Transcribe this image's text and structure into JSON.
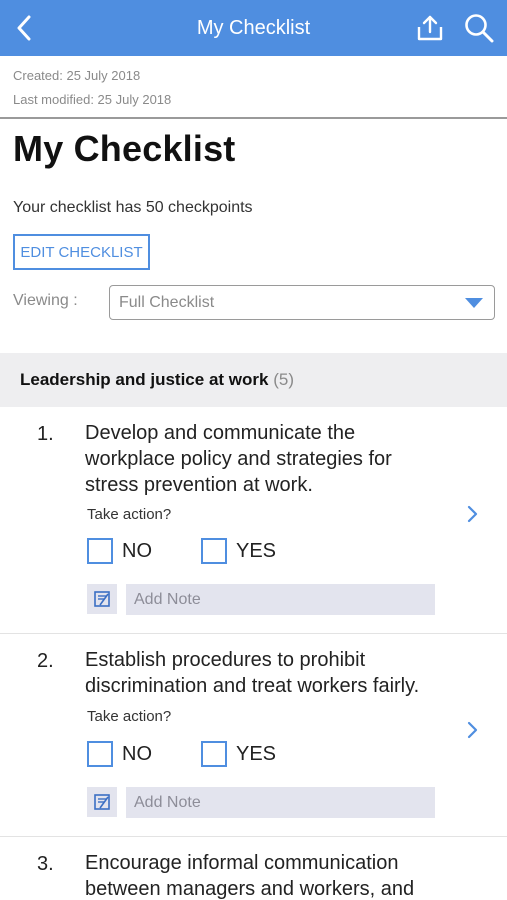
{
  "header": {
    "title": "My Checklist",
    "back_icon": "chevron-left-icon",
    "share_icon": "share-icon",
    "search_icon": "search-icon",
    "bar_color": "#4f8ee0"
  },
  "meta": {
    "created": "Created: 25 July 2018",
    "last_modified": "Last modified: 25 July 2018"
  },
  "page": {
    "title": "My Checklist",
    "summary": "Your checklist has 50 checkpoints",
    "edit_button": "EDIT CHECKLIST",
    "viewing_label": "Viewing :",
    "viewing_value": "Full Checklist"
  },
  "section": {
    "name": "Leadership and justice at work",
    "count": "(5)"
  },
  "items": [
    {
      "number": "1.",
      "lines": [
        "Develop and communicate the",
        "workplace policy and strategies for",
        "stress prevention at work."
      ],
      "take_action": "Take action?",
      "no_label": "NO",
      "yes_label": "YES",
      "note_placeholder": "Add Note"
    },
    {
      "number": "2.",
      "lines": [
        "Establish procedures to prohibit",
        "discrimination and treat workers fairly."
      ],
      "take_action": "Take action?",
      "no_label": "NO",
      "yes_label": "YES",
      "note_placeholder": "Add Note"
    },
    {
      "number": "3.",
      "lines": [
        "Encourage informal communication",
        "between managers and workers, and"
      ]
    }
  ],
  "accent_color": "#4f8ee0"
}
